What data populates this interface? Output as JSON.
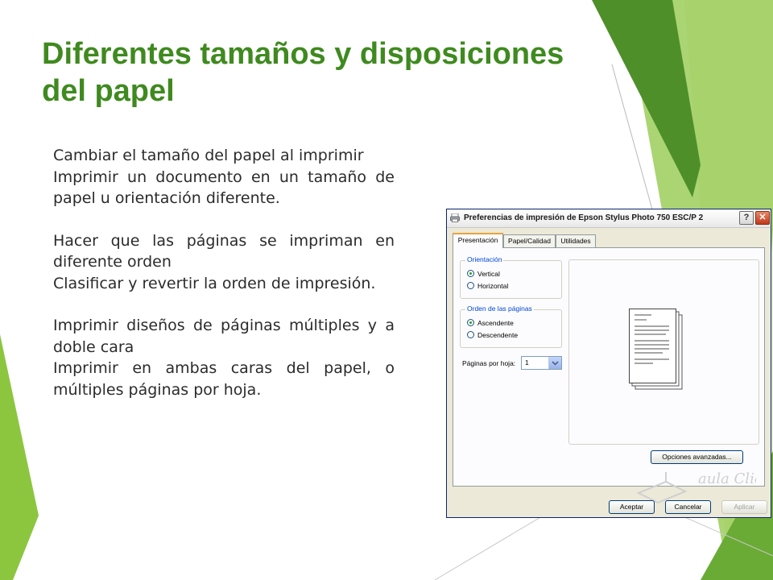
{
  "slide": {
    "title_line1": "Diferentes tamaños y disposiciones",
    "title_line2": "del papel",
    "paragraphs": [
      "Cambiar el tamaño del papel al imprimir",
      "Imprimir un documento en un tamaño de papel u orientación diferente.",
      "Hacer que las páginas se impriman en diferente orden",
      "Clasificar y revertir la orden de impresión.",
      "Imprimir diseños de páginas múltiples y a doble cara",
      "Imprimir en ambas caras del papel, o múltiples páginas por hoja."
    ]
  },
  "dialog": {
    "title": "Preferencias de impresión de Epson Stylus Photo 750 ESC/P 2",
    "help_glyph": "?",
    "close_glyph": "✕",
    "tabs": [
      "Presentación",
      "Papel/Calidad",
      "Utilidades"
    ],
    "orientation": {
      "legend": "Orientación",
      "options": [
        "Vertical",
        "Horizontal"
      ],
      "selected": "Vertical"
    },
    "page_order": {
      "legend": "Orden de las páginas",
      "options": [
        "Ascendente",
        "Descendente"
      ],
      "selected": "Ascendente"
    },
    "pages_per_sheet": {
      "label": "Páginas por hoja:",
      "value": "1"
    },
    "buttons": {
      "advanced": "Opciones avanzadas...",
      "accept": "Aceptar",
      "cancel": "Cancelar",
      "apply": "Aplicar"
    },
    "watermark_text": "aula Clic"
  },
  "colors": {
    "title_green": "#3f8a1f",
    "accent_lime": "#8cc63f",
    "accent_dark_green": "#4e8f2a"
  }
}
